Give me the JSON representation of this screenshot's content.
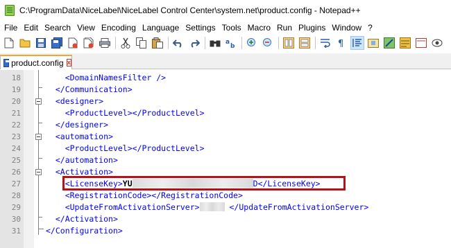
{
  "window": {
    "title": "C:\\ProgramData\\NiceLabel\\NiceLabel Control Center\\system.net\\product.config - Notepad++"
  },
  "menu": [
    "File",
    "Edit",
    "Search",
    "View",
    "Encoding",
    "Language",
    "Settings",
    "Tools",
    "Macro",
    "Run",
    "Plugins",
    "Window",
    "?"
  ],
  "toolbar": {
    "icons": [
      "new-file-icon",
      "open-file-icon",
      "save-icon",
      "save-all-icon",
      "close-icon",
      "close-all-icon",
      "print-icon",
      "cut-icon",
      "copy-icon",
      "paste-icon",
      "undo-icon",
      "redo-icon",
      "find-icon",
      "replace-icon",
      "zoom-in-icon",
      "zoom-out-icon",
      "sync-vertical-icon",
      "sync-horizontal-icon",
      "word-wrap-icon",
      "show-all-chars-icon",
      "indent-guide-icon",
      "doc-map-icon",
      "function-list-icon",
      "folder-workspace-icon",
      "monitoring-icon",
      "record-macro-icon"
    ]
  },
  "tab": {
    "label": "product.config",
    "close": "x"
  },
  "editor": {
    "lines": [
      {
        "num": "18",
        "indent": "    ",
        "open": "<DomainNamesFilter />",
        "text": "",
        "close": ""
      },
      {
        "num": "19",
        "indent": "  ",
        "open": "</Communication>",
        "text": "",
        "close": ""
      },
      {
        "num": "20",
        "indent": "  ",
        "open": "<designer>",
        "text": "",
        "close": ""
      },
      {
        "num": "21",
        "indent": "    ",
        "open": "<ProductLevel>",
        "text": "",
        "close": "</ProductLevel>"
      },
      {
        "num": "22",
        "indent": "  ",
        "open": "</designer>",
        "text": "",
        "close": ""
      },
      {
        "num": "23",
        "indent": "  ",
        "open": "<automation>",
        "text": "",
        "close": ""
      },
      {
        "num": "24",
        "indent": "    ",
        "open": "<ProductLevel>",
        "text": "",
        "close": "</ProductLevel>"
      },
      {
        "num": "25",
        "indent": "  ",
        "open": "</automation>",
        "text": "",
        "close": ""
      },
      {
        "num": "26",
        "indent": "  ",
        "open": "<Activation>",
        "text": "",
        "close": ""
      },
      {
        "num": "27",
        "indent": "    ",
        "open": "<LicenseKey>",
        "text": "YU",
        "close": "D</LicenseKey>"
      },
      {
        "num": "28",
        "indent": "    ",
        "open": "<RegistrationCode>",
        "text": "",
        "close": "</RegistrationCode>"
      },
      {
        "num": "29",
        "indent": "    ",
        "open": "<UpdateFromActivationServer>",
        "text": "",
        "close": " </UpdateFromActivationServer>"
      },
      {
        "num": "30",
        "indent": "  ",
        "open": "</Activation>",
        "text": "",
        "close": ""
      },
      {
        "num": "31",
        "indent": "",
        "open": "</Configuration>",
        "text": "",
        "close": ""
      }
    ]
  },
  "colors": {
    "tag": "#0000ff",
    "highlight_border": "#b0141a",
    "tab_accent": "#f7a42c"
  }
}
